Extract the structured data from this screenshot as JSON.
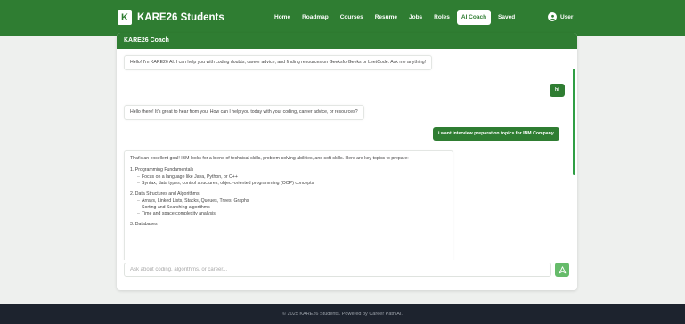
{
  "brand": {
    "logo_letter": "K",
    "name": "KARE26 Students"
  },
  "nav": [
    {
      "label": "Home",
      "active": false
    },
    {
      "label": "Roadmap",
      "active": false
    },
    {
      "label": "Courses",
      "active": false
    },
    {
      "label": "Resume",
      "active": false
    },
    {
      "label": "Jobs",
      "active": false
    },
    {
      "label": "Roles",
      "active": false
    },
    {
      "label": "AI Coach",
      "active": true
    },
    {
      "label": "Saved",
      "active": false
    }
  ],
  "user": {
    "icon": "user-icon",
    "label": "User"
  },
  "chat": {
    "header": "KARE26 Coach",
    "messages": [
      {
        "role": "ai",
        "text": "Hello! I'm KARE26 AI. I can help you with coding doubts, career advice, and finding resources on GeeksforGeeks or LeetCode. Ask me anything!"
      },
      {
        "role": "user",
        "text": "hi"
      },
      {
        "role": "ai",
        "text": "Hello there! It's great to hear from you. How can I help you today with your coding, career advice, or resources?"
      },
      {
        "role": "user",
        "text": "i want interview preparation topics for IBM Company"
      }
    ],
    "long_reply": {
      "intro": "That's an excellent goal! IBM looks for a blend of technical skills, problem-solving abilities, and soft skills. Here are key topics to prepare:",
      "topics": [
        {
          "title": "1. Programming Fundamentals",
          "items": [
            "Focus on a language like Java, Python, or C++",
            "Syntax, data types, control structures, object-oriented programming (OOP) concepts"
          ]
        },
        {
          "title": "2. Data Structures and Algorithms",
          "items": [
            "Arrays, Linked Lists, Stacks, Queues, Trees, Graphs",
            "Sorting and Searching algorithms",
            "Time and space complexity analysis"
          ]
        },
        {
          "title": "3. Databases",
          "items": []
        }
      ]
    },
    "input_placeholder": "Ask about coding, algorithms, or career...",
    "send_icon": "send-icon"
  },
  "footer": {
    "text": "© 2025 KARE26 Students. Powered by Career Path AI."
  },
  "colors": {
    "primary": "#2f7d32",
    "send": "#66bb6a",
    "footer_bg": "#1d232e"
  }
}
